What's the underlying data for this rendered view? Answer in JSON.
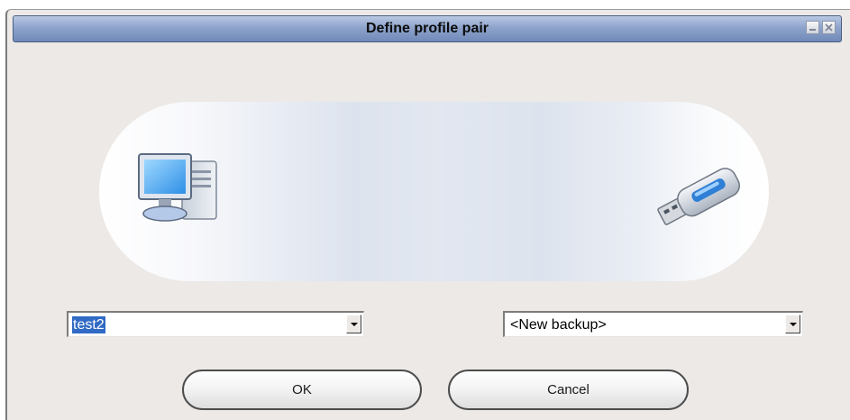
{
  "window": {
    "title": "Define profile pair"
  },
  "icons": {
    "left": "computer-icon",
    "right": "usb-drive-icon",
    "minimize": "minimize-icon",
    "close": "close-icon"
  },
  "profile": {
    "left_value": "test2",
    "right_value": "<New backup>"
  },
  "buttons": {
    "ok_label": "OK",
    "cancel_label": "Cancel"
  },
  "colors": {
    "selection": "#316ac5",
    "window_bg": "#ece9e6"
  }
}
